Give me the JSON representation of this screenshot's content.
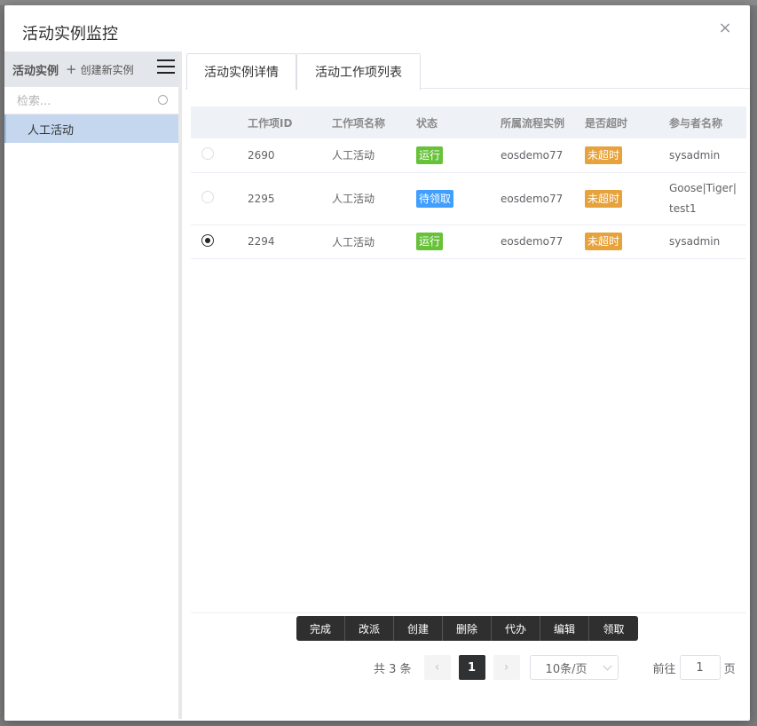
{
  "dialog": {
    "title": "活动实例监控",
    "close_icon": "×"
  },
  "left": {
    "title": "活动实例",
    "create_label": "创建新实例",
    "search_placeholder": "检索...",
    "items": [
      {
        "label": "人工活动"
      }
    ]
  },
  "tabs": [
    {
      "label": "活动实例详情"
    },
    {
      "label": "活动工作项列表",
      "active": true
    }
  ],
  "table": {
    "columns": [
      "工作项ID",
      "工作项名称",
      "状态",
      "所属流程实例",
      "是否超时",
      "参与者名称"
    ],
    "rows": [
      {
        "id": "2690",
        "name": "人工活动",
        "status": "运行",
        "status_color": "#67c23a",
        "process": "eosdemo77",
        "timeout": "未超时",
        "participant": "sysadmin",
        "selected": false
      },
      {
        "id": "2295",
        "name": "人工活动",
        "status": "待领取",
        "status_color": "#409eff",
        "process": "eosdemo77",
        "timeout": "未超时",
        "participant": "Goose|Tiger|test1",
        "selected": false
      },
      {
        "id": "2294",
        "name": "人工活动",
        "status": "运行",
        "status_color": "#67c23a",
        "process": "eosdemo77",
        "timeout": "未超时",
        "participant": "sysadmin",
        "selected": true
      }
    ]
  },
  "actions": [
    "完成",
    "改派",
    "创建",
    "删除",
    "代办",
    "编辑",
    "领取"
  ],
  "pager": {
    "total": "共 3 条",
    "current_page": "1",
    "page_size": "10条/页",
    "goto_label": "前往",
    "goto_value": "1",
    "page_suffix": "页"
  }
}
